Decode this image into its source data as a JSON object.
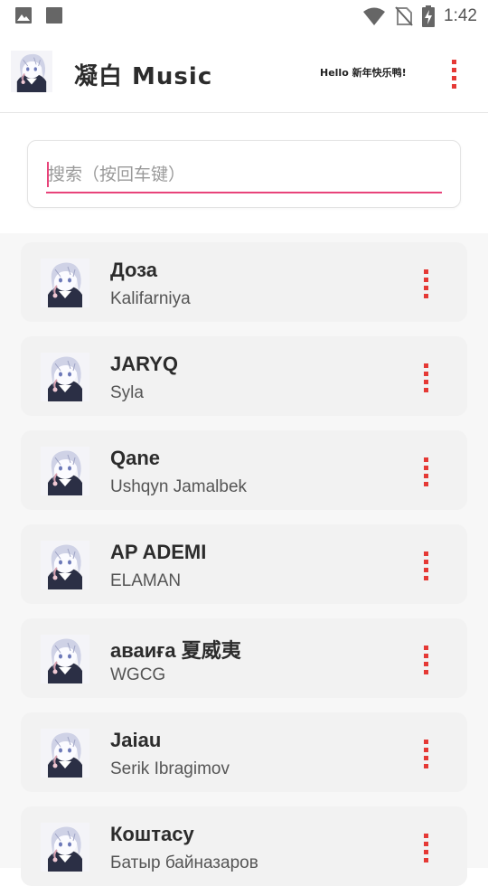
{
  "status_bar": {
    "time": "1:42",
    "icons": [
      "image-icon",
      "square-icon",
      "wifi-icon",
      "no-sim-icon",
      "battery-charging-icon"
    ]
  },
  "app_bar": {
    "title": "凝白 Music",
    "greeting": "Hello 新年快乐鸭!",
    "menu_icon": "more-vert-icon",
    "accent_color": "#e53935"
  },
  "search": {
    "placeholder": "搜索（按回车键）",
    "value": "",
    "underline_color": "#e8437a"
  },
  "songs": [
    {
      "title": "Доза",
      "artist": "Kalifarniya"
    },
    {
      "title": "JARYQ",
      "artist": "Syla"
    },
    {
      "title": "Qane",
      "artist": "Ushqyn Jamalbek"
    },
    {
      "title": "AP ADEMI",
      "artist": "ELAMAN"
    },
    {
      "title": "аваиға 夏威夷",
      "artist": "WGCG"
    },
    {
      "title": "Jaiau",
      "artist": "Serik Ibragimov"
    },
    {
      "title": "Коштасу",
      "artist": "Батыр байназаров"
    }
  ]
}
